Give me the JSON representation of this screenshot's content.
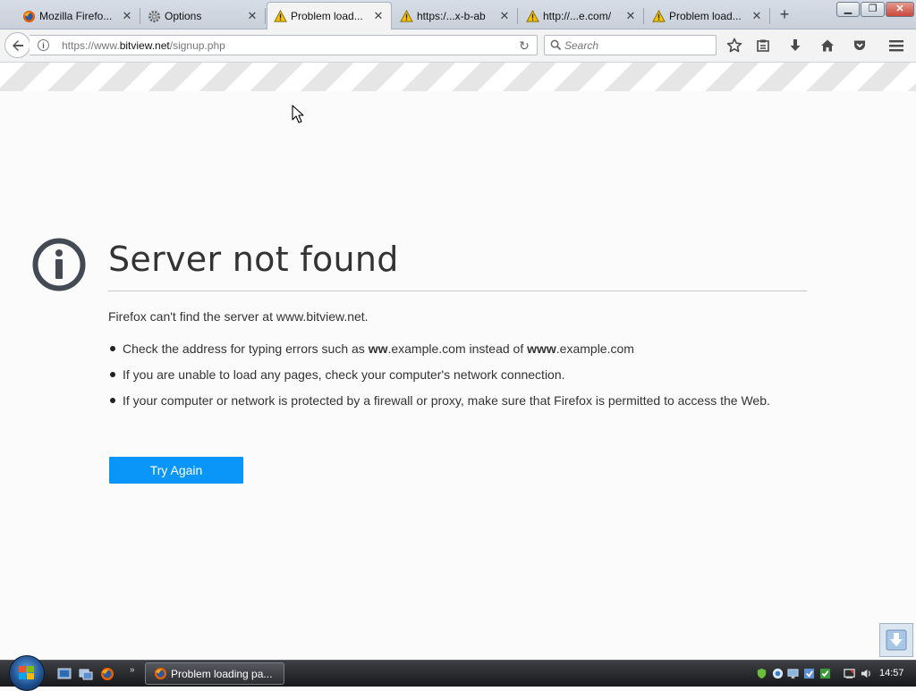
{
  "tabs": [
    {
      "title": "Mozilla Firefo...",
      "icon": "firefox-icon",
      "active": false
    },
    {
      "title": "Options",
      "icon": "gear-icon",
      "active": false
    },
    {
      "title": "Problem load...",
      "icon": "warning-icon",
      "active": true
    },
    {
      "title": "https:/...x-b-ab",
      "icon": "warning-icon",
      "active": false
    },
    {
      "title": "http://...e.com/",
      "icon": "warning-icon",
      "active": false
    },
    {
      "title": "Problem load...",
      "icon": "warning-icon",
      "active": false
    }
  ],
  "navbar": {
    "url_prefix": "https://www.",
    "url_domain": "bitview.net",
    "url_path": "/signup.php",
    "search_placeholder": "Search"
  },
  "error": {
    "title": "Server not found",
    "description": "Firefox can't find the server at www.bitview.net.",
    "item1_a": "Check the address for typing errors such as ",
    "item1_b": "ww",
    "item1_c": ".example.com instead of ",
    "item1_d": "www",
    "item1_e": ".example.com",
    "item2": "If you are unable to load any pages, check your computer's network connection.",
    "item3": "If your computer or network is protected by a firewall or proxy, make sure that Firefox is permitted to access the Web.",
    "try_again_label": "Try Again"
  },
  "taskbar": {
    "task_label": "Problem loading pa...",
    "clock": "14:57"
  },
  "colors": {
    "accent": "#0996f8",
    "warning": "#f2c200"
  }
}
